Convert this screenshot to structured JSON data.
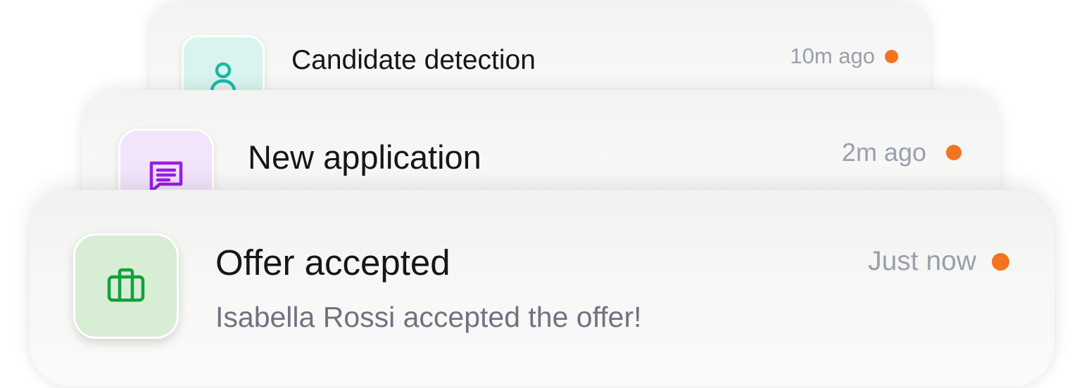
{
  "notifications": [
    {
      "title": "Candidate detection",
      "time": "10m ago",
      "icon": "user-icon",
      "icon_color": "#1cb8a3",
      "tile_color": "#d9f3ef",
      "unread_color": "#f47321"
    },
    {
      "title": "New application",
      "time": "2m ago",
      "icon": "message-icon",
      "icon_color": "#9b1de8",
      "tile_color": "#f1e4fb",
      "unread_color": "#f47321"
    },
    {
      "title": "Offer accepted",
      "subtitle": "Isabella Rossi accepted the offer!",
      "time": "Just now",
      "icon": "briefcase-icon",
      "icon_color": "#12a13c",
      "tile_color": "#d7eed5",
      "unread_color": "#f47321"
    }
  ]
}
